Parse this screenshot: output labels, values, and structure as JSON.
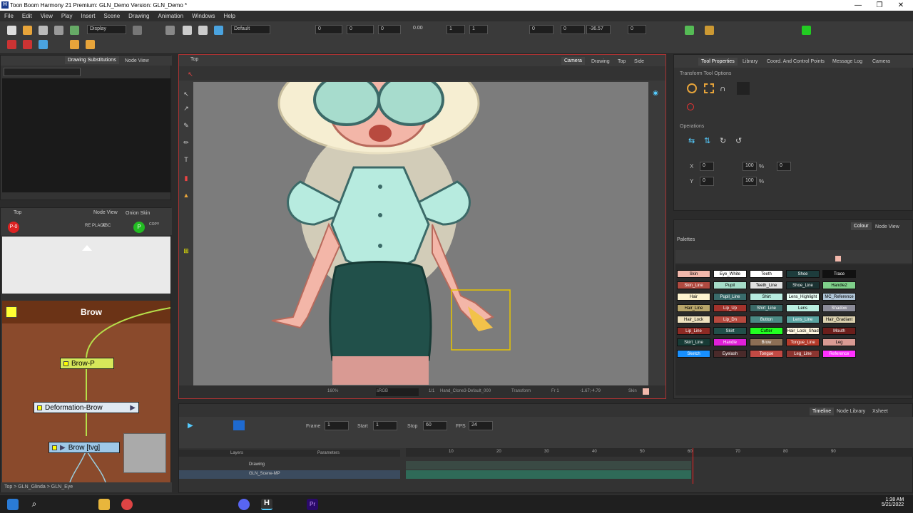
{
  "window": {
    "title": "Toon Boom Harmony 21 Premium: GLN_Demo Version: GLN_Demo *",
    "logo": "H",
    "minimize": "—",
    "maximize": "❐",
    "close": "✕"
  },
  "menu": [
    "File",
    "Edit",
    "View",
    "Play",
    "Insert",
    "Scene",
    "Drawing",
    "Animation",
    "Windows",
    "Help"
  ],
  "toolbar": {
    "display_select": "Display",
    "default_select": "Default",
    "fields": [
      "0",
      "0",
      "0",
      "0.00",
      "1",
      "1",
      "0",
      "0",
      "-36.57",
      "0"
    ]
  },
  "drawing_subs": {
    "tab1": "Drawing Substitutions",
    "tab2": "Node View"
  },
  "node_view": {
    "path": "Top",
    "tab1": "Node View",
    "tab2": "Onion Skin",
    "group_title": "Brow",
    "nodes": [
      "Brow-P",
      "Deformation-Brow",
      "Brow [tvg]"
    ],
    "breadcrumb": [
      "Top",
      "GLN_Glinda",
      "GLN_Eye"
    ],
    "replace_label": "RE PLACE",
    "abc_label": "ABC",
    "copy_label": "COPY"
  },
  "viewer": {
    "path": "Top",
    "tabs": [
      "Camera",
      "Drawing",
      "Top",
      "Side"
    ],
    "active_tab": "Camera",
    "status": {
      "zoom": "160%",
      "colorspace": "sRGB",
      "ratio": "1/1",
      "drawing": "Hand_Clone3-Default_000",
      "tool": "Transform",
      "frame": "Fr 1",
      "coords": "-1.67;-4.79",
      "swatch": "Skin"
    }
  },
  "tool_props": {
    "tabs": [
      "Tool Properties",
      "Library",
      "Coord. And Control Points",
      "Message Log",
      "Camera"
    ],
    "section1": "Transform Tool Options",
    "section2": "Operations",
    "x_label": "X",
    "y_label": "Y",
    "x": "0",
    "y": "0",
    "w": "100",
    "h": "100",
    "angle": "0",
    "pct1": "%",
    "pct2": "%"
  },
  "colour": {
    "tabs": [
      "Colour",
      "Node View"
    ],
    "palettes_label": "Palettes",
    "swatches": [
      {
        "name": "Skin",
        "bg": "#f2b8ab",
        "fg": "#000"
      },
      {
        "name": "Eye_White",
        "bg": "#ffffff",
        "fg": "#000"
      },
      {
        "name": "Teeth",
        "bg": "#ffffff",
        "fg": "#000"
      },
      {
        "name": "Shoe",
        "bg": "#1d3c3c",
        "fg": "#fff"
      },
      {
        "name": "Trace",
        "bg": "#111111",
        "fg": "#fff"
      },
      {
        "name": "Skin_Line",
        "bg": "#b04a40",
        "fg": "#fff"
      },
      {
        "name": "Pupil",
        "bg": "#a5dcc8",
        "fg": "#000"
      },
      {
        "name": "Teeth_Line",
        "bg": "#e0e0e0",
        "fg": "#000"
      },
      {
        "name": "Shoe_Line",
        "bg": "#1b3232",
        "fg": "#fff"
      },
      {
        "name": "Handle2",
        "bg": "#7fd08a",
        "fg": "#000"
      },
      {
        "name": "Hair",
        "bg": "#fdf3cf",
        "fg": "#000"
      },
      {
        "name": "Pupil_Line",
        "bg": "#3a6b6b",
        "fg": "#fff"
      },
      {
        "name": "Shirt",
        "bg": "#b7ebdf",
        "fg": "#000"
      },
      {
        "name": "Lens_Highlight",
        "bg": "#eafff6",
        "fg": "#000"
      },
      {
        "name": "MC_Reference",
        "bg": "#b0c6d8",
        "fg": "#000"
      },
      {
        "name": "Hair_Line",
        "bg": "#b8a56a",
        "fg": "#000"
      },
      {
        "name": "Lip_Up",
        "bg": "#a2332c",
        "fg": "#fff"
      },
      {
        "name": "Shirt_Line",
        "bg": "#3c6a68",
        "fg": "#fff"
      },
      {
        "name": "Lens",
        "bg": "#b9eee0",
        "fg": "#000"
      },
      {
        "name": "Shadow",
        "bg": "#8c8c99",
        "fg": "#fff"
      },
      {
        "name": "Hair_Lock",
        "bg": "#efe2bf",
        "fg": "#000"
      },
      {
        "name": "Lip_Dn",
        "bg": "#b84a3f",
        "fg": "#fff"
      },
      {
        "name": "Button",
        "bg": "#4b8a84",
        "fg": "#fff"
      },
      {
        "name": "Lens_Line",
        "bg": "#5aa3a0",
        "fg": "#fff"
      },
      {
        "name": "Hair_Gradiant",
        "bg": "#ddd2b0",
        "fg": "#000"
      },
      {
        "name": "Lip_Line",
        "bg": "#8d2a24",
        "fg": "#fff"
      },
      {
        "name": "Skirt",
        "bg": "#21504a",
        "fg": "#fff"
      },
      {
        "name": "Cutter",
        "bg": "#22ff22",
        "fg": "#000"
      },
      {
        "name": "Hair_Lock_Shad",
        "bg": "#fff7e0",
        "fg": "#000"
      },
      {
        "name": "Mouth",
        "bg": "#6b1e1b",
        "fg": "#fff"
      },
      {
        "name": "Skirt_Line",
        "bg": "#173b36",
        "fg": "#fff"
      },
      {
        "name": "Handle",
        "bg": "#e020d8",
        "fg": "#fff"
      },
      {
        "name": "Brow",
        "bg": "#8c6f55",
        "fg": "#fff"
      },
      {
        "name": "Tongue_Line",
        "bg": "#b53a2a",
        "fg": "#fff"
      },
      {
        "name": "Leg",
        "bg": "#d99a93",
        "fg": "#000"
      },
      {
        "name": "Sketch",
        "bg": "#1890ff",
        "fg": "#fff"
      },
      {
        "name": "Eyelash",
        "bg": "#4a2a2a",
        "fg": "#fff"
      },
      {
        "name": "Tongue",
        "bg": "#c24a44",
        "fg": "#fff"
      },
      {
        "name": "Leg_Line",
        "bg": "#8c3530",
        "fg": "#fff"
      },
      {
        "name": "Reference",
        "bg": "#ff30ff",
        "fg": "#fff"
      }
    ]
  },
  "timeline": {
    "tabs": [
      "Timeline",
      "Node Library",
      "Xsheet"
    ],
    "frame_label": "Frame",
    "frame": "1",
    "start_label": "Start",
    "start": "1",
    "stop_label": "Stop",
    "stop": "60",
    "fps_label": "FPS",
    "fps": "24",
    "layers_header": "Layers",
    "params_header": "Parameters",
    "layers": [
      "Drawing",
      "GLN_Scene-MP"
    ],
    "ruler": [
      "10",
      "20",
      "30",
      "40",
      "50",
      "60",
      "70",
      "80",
      "90"
    ],
    "playhead": 60
  },
  "taskbar": {
    "time": "1:38 AM",
    "date": "5/21/2022"
  }
}
